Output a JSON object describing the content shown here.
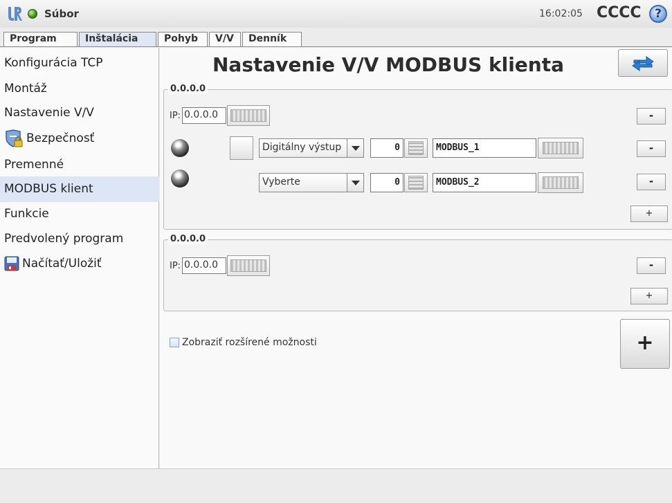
{
  "header": {
    "file_menu": "Súbor",
    "time": "16:02:05",
    "robot_name": "CCCC",
    "help_symbol": "?"
  },
  "tabs": [
    {
      "label": "Program",
      "active": false
    },
    {
      "label": "Inštalácia",
      "active": true
    },
    {
      "label": "Pohyb",
      "active": false
    },
    {
      "label": "V/V",
      "active": false
    },
    {
      "label": "Denník",
      "active": false
    }
  ],
  "sidebar": {
    "items": [
      {
        "label": "Konfigurácia TCP",
        "icon": ""
      },
      {
        "label": "Montáž",
        "icon": ""
      },
      {
        "label": "Nastavenie V/V",
        "icon": ""
      },
      {
        "label": "Bezpečnosť",
        "icon": "shield-lock-icon"
      },
      {
        "label": "Premenné",
        "icon": ""
      },
      {
        "label": "MODBUS klient",
        "icon": "",
        "active": true
      },
      {
        "label": "Funkcie",
        "icon": ""
      },
      {
        "label": "Predvolený program",
        "icon": ""
      },
      {
        "label": "Načítať/Uložiť",
        "icon": "floppy-icon"
      }
    ]
  },
  "main": {
    "title": "Nastavenie V/V MODBUS klienta",
    "units": [
      {
        "address": "0.0.0.0",
        "ip_label": "IP:",
        "ip_value": "0.0.0.0",
        "remove_label": "-",
        "add_signal_label": "+",
        "signals": [
          {
            "type": "Digitálny výstup",
            "address": "0",
            "name": "MODBUS_1",
            "remove_label": "-"
          },
          {
            "type": "Vyberte",
            "address": "0",
            "name": "MODBUS_2",
            "remove_label": "-"
          }
        ]
      },
      {
        "address": "0.0.0.0",
        "ip_label": "IP:",
        "ip_value": "0.0.0.0",
        "remove_label": "-",
        "add_signal_label": "+",
        "signals": []
      }
    ],
    "advanced_label": "Zobraziť rozšírené možnosti",
    "advanced_checked": false,
    "add_unit_label": "+"
  },
  "colors": {
    "status_ok": "#3e9a12",
    "selected_bg": "#dde6f5",
    "refresh_arrow": "#2a7fd4"
  }
}
